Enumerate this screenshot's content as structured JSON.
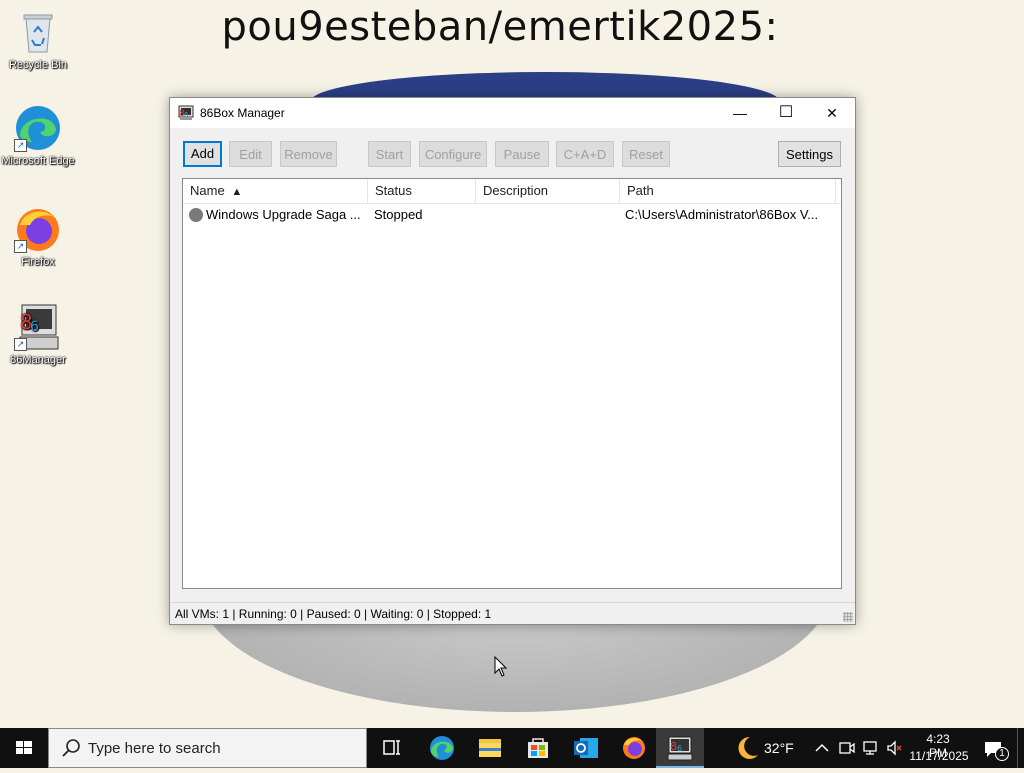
{
  "wallpaper": {
    "title": "pou9esteban/emertik2025:"
  },
  "desktop": {
    "icons": [
      {
        "label": "Recycle Bin"
      },
      {
        "label": "Microsoft Edge"
      },
      {
        "label": "Firefox"
      },
      {
        "label": "86Manager"
      }
    ]
  },
  "window": {
    "title": "86Box Manager",
    "controls": {
      "minimize": "—",
      "maximize": "☐",
      "close": "✕"
    },
    "toolbar": {
      "add": "Add",
      "edit": "Edit",
      "remove": "Remove",
      "start": "Start",
      "configure": "Configure",
      "pause": "Pause",
      "cad": "C+A+D",
      "reset": "Reset",
      "settings": "Settings"
    },
    "list": {
      "columns": {
        "name": "Name",
        "sort_arrow": "▲",
        "status": "Status",
        "description": "Description",
        "path": "Path"
      },
      "rows": [
        {
          "name": "Windows Upgrade Saga ...",
          "status": "Stopped",
          "description": "",
          "path": "C:\\Users\\Administrator\\86Box V..."
        }
      ]
    },
    "statusbar": "All VMs: 1 | Running: 0 | Paused: 0 | Waiting: 0 | Stopped: 1"
  },
  "taskbar": {
    "search_placeholder": "Type here to search",
    "weather": "32°F",
    "time": "4:23 PM",
    "date": "11/17/2025",
    "notification_count": "1"
  },
  "colors": {
    "accent": "#0078d7",
    "taskbar": "#101010",
    "wallpaper": "#f6f3e6"
  }
}
